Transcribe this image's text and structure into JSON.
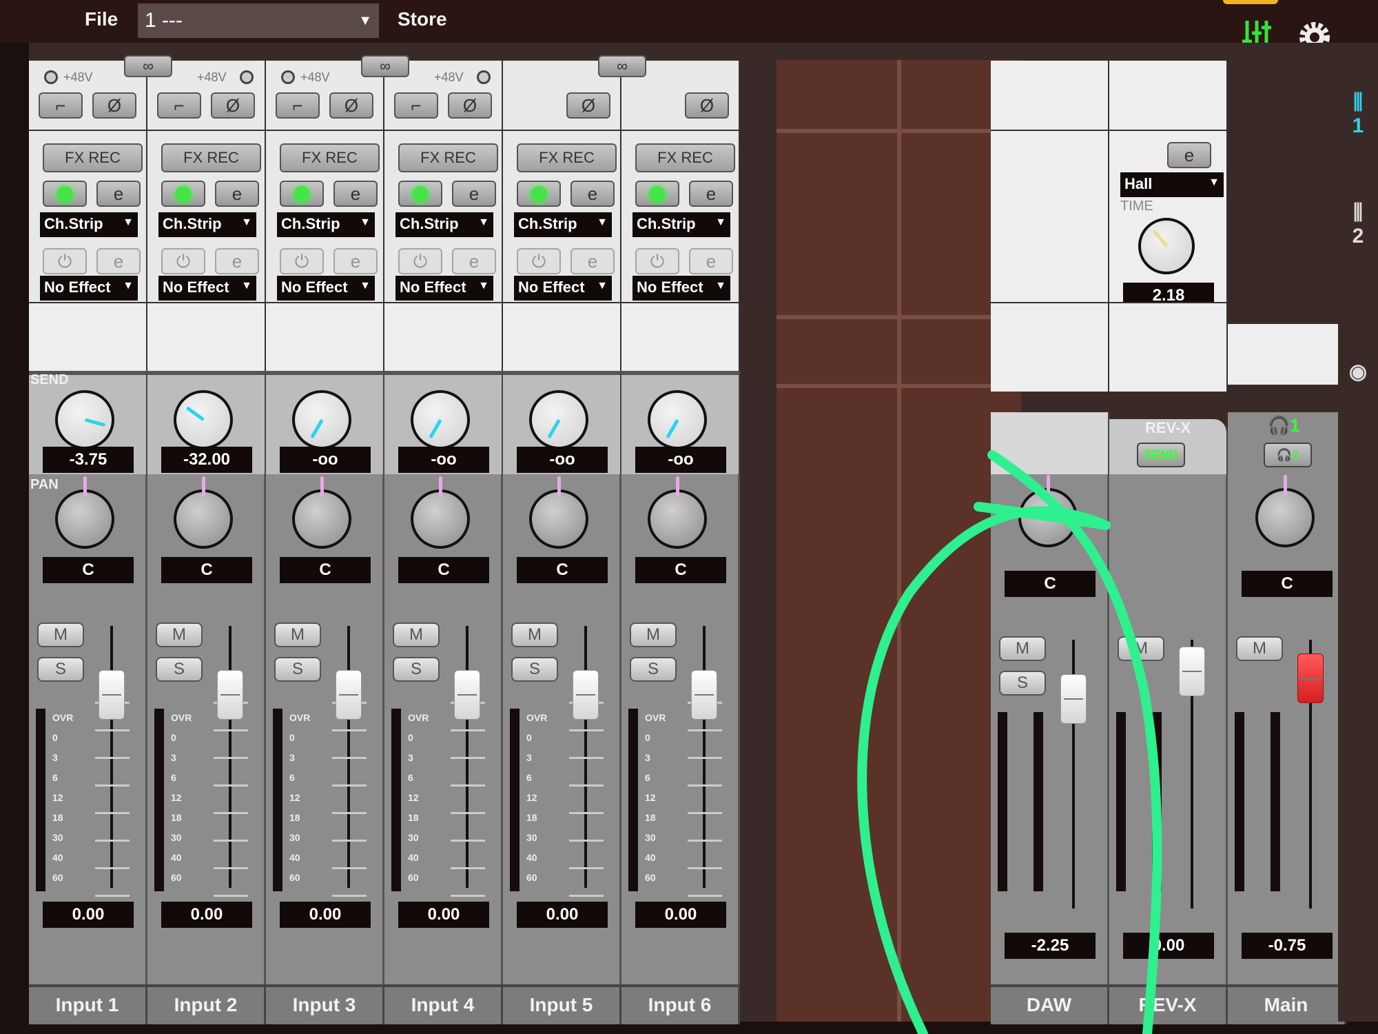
{
  "topbar": {
    "file_label": "File",
    "preset_value": "1 ---",
    "store_label": "Store",
    "icons": [
      "mixer-view-icon",
      "settings-gear-icon"
    ]
  },
  "input_strips": [
    {
      "name": "Input 1",
      "phantom": "+48V",
      "hpf": true,
      "phase": true,
      "fx_rec": "FX REC",
      "slot1": "Ch.Strip",
      "slot1_on": true,
      "slot2": "No Effect",
      "send": "-3.75",
      "send_level": 0.85,
      "pan": "C",
      "fader": "0.00",
      "fader_level": 0.78
    },
    {
      "name": "Input 2",
      "phantom": "+48V",
      "hpf": true,
      "phase": true,
      "fx_rec": "FX REC",
      "slot1": "Ch.Strip",
      "slot1_on": true,
      "slot2": "No Effect",
      "send": "-32.00",
      "send_level": 0.32,
      "pan": "C",
      "fader": "0.00",
      "fader_level": 0.78
    },
    {
      "name": "Input 3",
      "phantom": "+48V",
      "hpf": true,
      "phase": true,
      "fx_rec": "FX REC",
      "slot1": "Ch.Strip",
      "slot1_on": true,
      "slot2": "No Effect",
      "send": "-oo",
      "send_level": 0.0,
      "pan": "C",
      "fader": "0.00",
      "fader_level": 0.78
    },
    {
      "name": "Input 4",
      "phantom": "+48V",
      "hpf": true,
      "phase": true,
      "fx_rec": "FX REC",
      "slot1": "Ch.Strip",
      "slot1_on": true,
      "slot2": "No Effect",
      "send": "-oo",
      "send_level": 0.0,
      "pan": "C",
      "fader": "0.00",
      "fader_level": 0.78
    },
    {
      "name": "Input 5",
      "phantom": "",
      "hpf": false,
      "phase": true,
      "fx_rec": "FX REC",
      "slot1": "Ch.Strip",
      "slot1_on": true,
      "slot2": "No Effect",
      "send": "-oo",
      "send_level": 0.0,
      "pan": "C",
      "fader": "0.00",
      "fader_level": 0.78
    },
    {
      "name": "Input 6",
      "phantom": "",
      "hpf": false,
      "phase": true,
      "fx_rec": "FX REC",
      "slot1": "Ch.Strip",
      "slot1_on": true,
      "slot2": "No Effect",
      "send": "-oo",
      "send_level": 0.0,
      "pan": "C",
      "fader": "0.00",
      "fader_level": 0.78
    }
  ],
  "meter_scale": [
    "OVR",
    "0",
    "3",
    "6",
    "12",
    "18",
    "30",
    "40",
    "60"
  ],
  "buttons": {
    "mute": "M",
    "solo": "S",
    "link": "link-icon",
    "phase": "Ø"
  },
  "labels": {
    "send": "SEND",
    "pan": "PAN"
  },
  "daw_strip": {
    "name": "DAW",
    "pan": "C",
    "fader": "-2.25",
    "fader_level": 0.72
  },
  "revx_strip": {
    "name": "REV-X",
    "title": "REV-X",
    "send_button": "SEND",
    "reverb_type": "Hall",
    "time_label": "TIME",
    "time_value": "2.18",
    "fader": "0.00",
    "fader_level": 0.78
  },
  "main_strip": {
    "name": "Main",
    "hp1": "1",
    "hp2": "2",
    "pan": "C",
    "fader": "-0.75",
    "fader_level": 0.76
  },
  "side_rail": {
    "item1": "1",
    "item2": "2"
  },
  "colors": {
    "send_needle": "#29d3f0",
    "pan_needle": "#e8a8e8",
    "active_green": "#3fe83f",
    "main_fader": "#e02828",
    "annotation": "#2ef08e"
  }
}
